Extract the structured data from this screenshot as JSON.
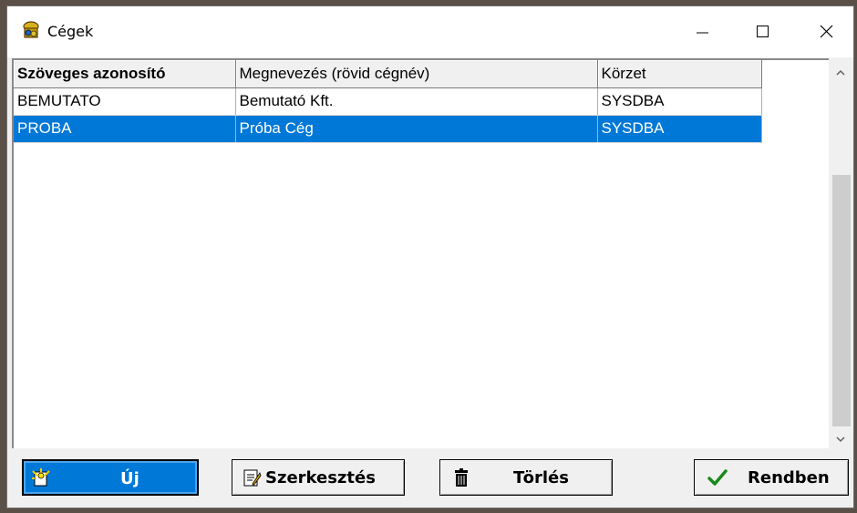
{
  "window": {
    "title": "Cégek"
  },
  "titlebar": {
    "minimize_icon": "minimize-icon",
    "maximize_icon": "maximize-icon",
    "close_icon": "close-icon"
  },
  "grid": {
    "columns": [
      "Szöveges azonosító",
      "Megnevezés (rövid cégnév)",
      "Körzet"
    ],
    "rows": [
      [
        "BEMUTATO",
        "Bemutató Kft.",
        "SYSDBA"
      ],
      [
        "PROBA",
        "Próba Cég",
        "SYSDBA"
      ]
    ],
    "selected_row": 1
  },
  "buttons": {
    "new": "Új",
    "edit": "Szerkesztés",
    "delete": "Törlés",
    "ok": "Rendben"
  },
  "colors": {
    "selection": "#0078d7",
    "ok_check": "#1a8a1a"
  }
}
